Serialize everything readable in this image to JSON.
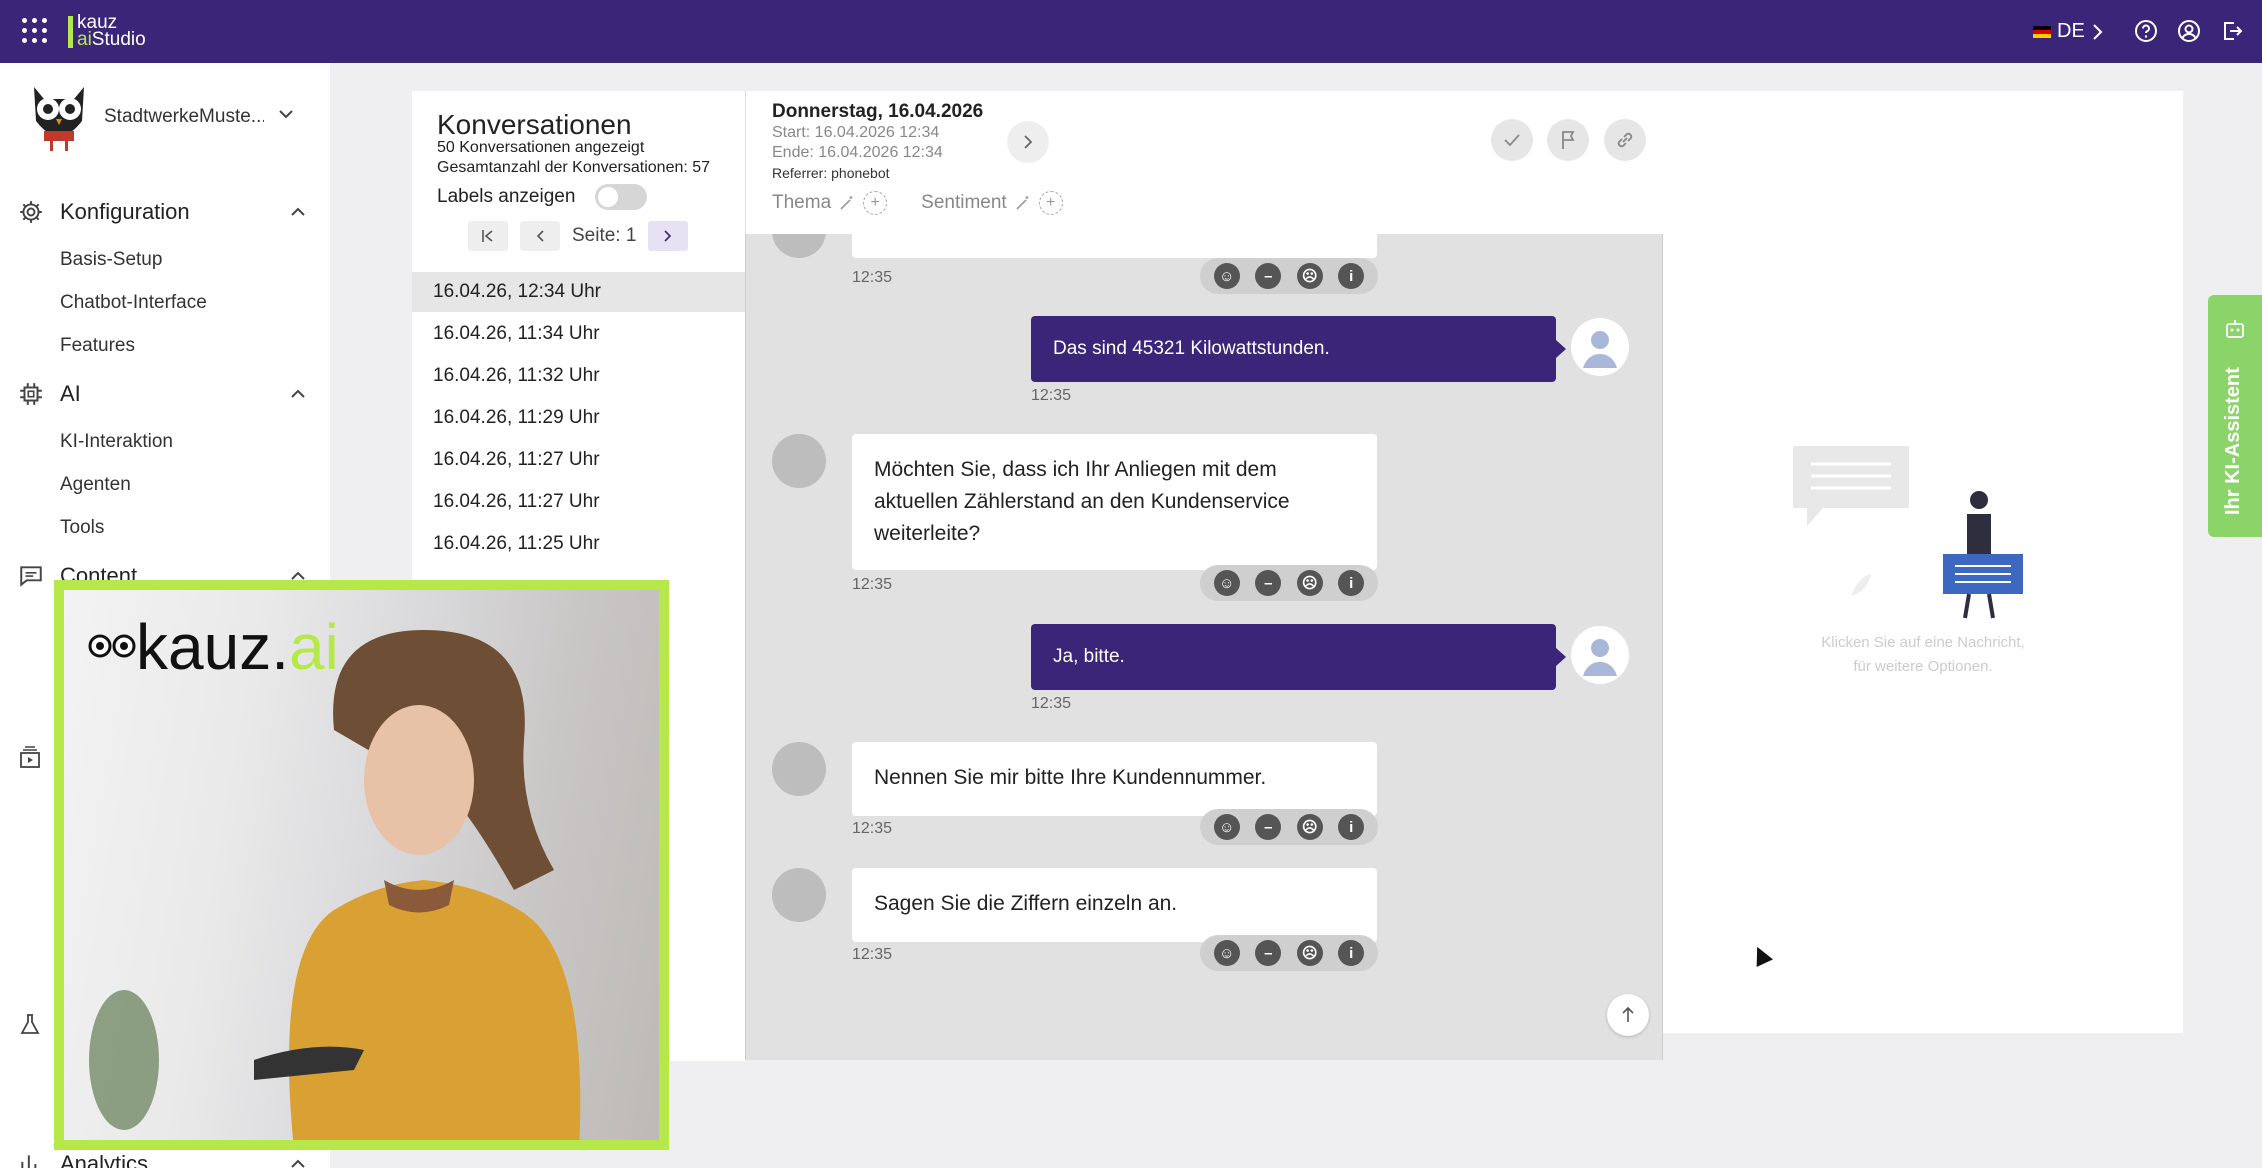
{
  "app": {
    "logo_line1": "kauz",
    "logo_line2_prefix": "ai",
    "logo_line2_suffix": "Studio",
    "language": "DE",
    "brand_color": "#3a2579",
    "accent_color": "#b6e84a"
  },
  "sidebar": {
    "tenant": "StadtwerkeMuste...",
    "sections": [
      {
        "title": "Konfiguration",
        "icon": "gear-icon",
        "items": [
          "Basis-Setup",
          "Chatbot-Interface",
          "Features"
        ]
      },
      {
        "title": "AI",
        "icon": "chip-icon",
        "items": [
          "KI-Interaktion",
          "Agenten",
          "Tools"
        ]
      },
      {
        "title": "Content",
        "icon": "message-square-icon",
        "items": []
      },
      {
        "title": "Analytics",
        "icon": "bar-chart-icon",
        "items": []
      }
    ]
  },
  "conversations": {
    "title": "Konversationen",
    "shown": "50 Konversationen angezeigt",
    "total": "Gesamtanzahl der Konversationen: 57",
    "labels_toggle": "Labels anzeigen",
    "page_label": "Seite: 1",
    "items": [
      "16.04.26, 12:34 Uhr",
      "16.04.26, 11:34 Uhr",
      "16.04.26, 11:32 Uhr",
      "16.04.26, 11:29 Uhr",
      "16.04.26, 11:27 Uhr",
      "16.04.26, 11:27 Uhr",
      "16.04.26, 11:25 Uhr"
    ]
  },
  "chat_header": {
    "date": "Donnerstag, 16.04.2026",
    "start": "Start: 16.04.2026 12:34",
    "end": "Ende: 16.04.2026 12:34",
    "referrer": "Referrer: phonebot",
    "thema": "Thema",
    "sentiment": "Sentiment"
  },
  "messages": [
    {
      "role": "user",
      "text": "Das sind 45321 Kilowattstunden.",
      "time": "12:35"
    },
    {
      "role": "bot",
      "text": "Möchten Sie, dass ich Ihr Anliegen mit dem aktuellen Zählerstand an den Kundenservice weiterleite?",
      "time": "12:35"
    },
    {
      "role": "user",
      "text": "Ja, bitte.",
      "time": "12:35"
    },
    {
      "role": "bot",
      "text": "Nennen Sie mir bitte Ihre Kundennummer.",
      "time": "12:35"
    },
    {
      "role": "bot",
      "text": "Sagen Sie die Ziffern einzeln an.",
      "time": "12:35"
    }
  ],
  "first_partial_time": "12:35",
  "right_panel": {
    "hint_line1": "Klicken Sie auf eine Nachricht,",
    "hint_line2": "für weitere Optionen."
  },
  "assistant_tab": "Ihr KI-Assistent",
  "video_overlay": {
    "logo_prefix": "kauz.",
    "logo_suffix": "ai"
  }
}
